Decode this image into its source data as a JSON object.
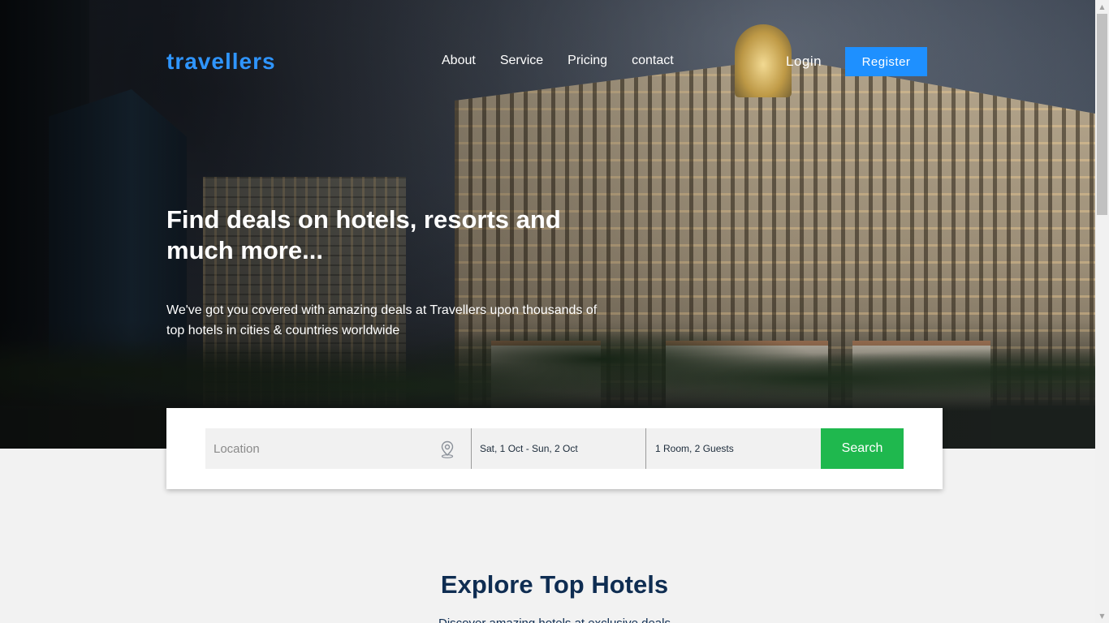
{
  "header": {
    "logo": "travellers",
    "nav": [
      {
        "label": "About"
      },
      {
        "label": "Service"
      },
      {
        "label": "Pricing"
      },
      {
        "label": "contact"
      }
    ],
    "login_label": "Login",
    "register_label": "Register"
  },
  "hero": {
    "headline": "Find deals on hotels, resorts and much more...",
    "subtext": "We've got you covered with amazing deals at Travellers upon thousands of top hotels in cities & countries worldwide"
  },
  "search": {
    "location_placeholder": "Location",
    "location_icon": "map-pin-icon",
    "dates": "Sat, 1 Oct - Sun, 2 Oct",
    "guests": "1 Room, 2 Guests",
    "button_label": "Search",
    "button_color": "#1fb84e"
  },
  "explore": {
    "title": "Explore Top Hotels",
    "subtitle": "Discover amazing hotels at exclusive deals"
  },
  "colors": {
    "brand": "#2f95ff",
    "register_bg": "#1e90ff",
    "heading": "#0f2d52"
  }
}
